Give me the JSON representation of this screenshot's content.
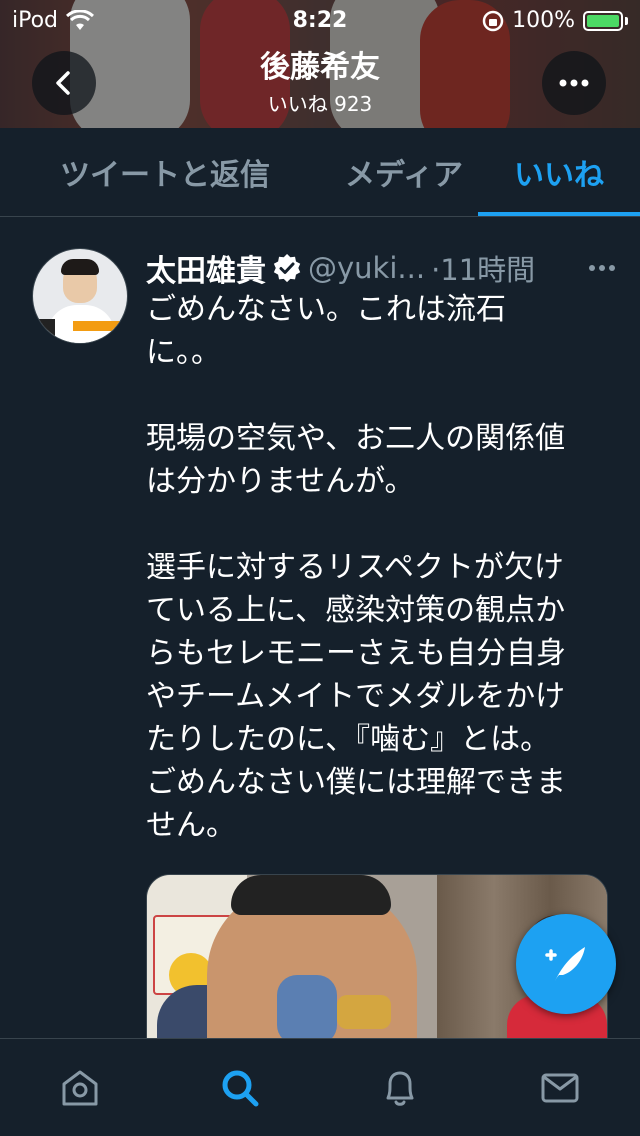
{
  "status_bar": {
    "carrier": "iPod",
    "time": "8:22",
    "battery": "100%",
    "battery_level": 1.0,
    "icons": [
      "wifi-icon",
      "orientation-lock-icon",
      "battery-charging-icon"
    ]
  },
  "header": {
    "profile_name": "後藤希友",
    "likes_count_label": "いいね 923",
    "back_icon": "chevron-left-icon",
    "more_icon": "more-horizontal-icon"
  },
  "tabs": [
    {
      "label": "ツイートと返信",
      "active": false
    },
    {
      "label": "メディア",
      "active": false
    },
    {
      "label": "いいね",
      "active": true
    }
  ],
  "tweet": {
    "author_name": "太田雄貴",
    "verified": true,
    "handle": "@yuki...",
    "time": "·11時間",
    "more_icon": "more-horizontal-icon",
    "paragraphs": [
      "ごめんなさい。これは流石\nに。。",
      "現場の空気や、お二人の関係値\nは分かりませんが。",
      "選手に対するリスペクトが欠け\nている上に、感染対策の観点か\nらもセレモニーさえも自分自身\nやチームメイトでメダルをかけ\nたりしたのに、『噛む』とは。\nごめんなさい僕には理解できま\nせん。"
    ]
  },
  "compose_button": {
    "icon": "compose-tweet-icon"
  },
  "bottom_nav": [
    {
      "name": "home",
      "icon": "home-icon",
      "active": false
    },
    {
      "name": "search",
      "icon": "search-icon",
      "active": true
    },
    {
      "name": "notifications",
      "icon": "bell-icon",
      "active": false
    },
    {
      "name": "messages",
      "icon": "mail-icon",
      "active": false
    }
  ],
  "colors": {
    "background": "#15202b",
    "accent": "#1da1f2",
    "muted_text": "#8899a6",
    "divider": "#38444d"
  }
}
